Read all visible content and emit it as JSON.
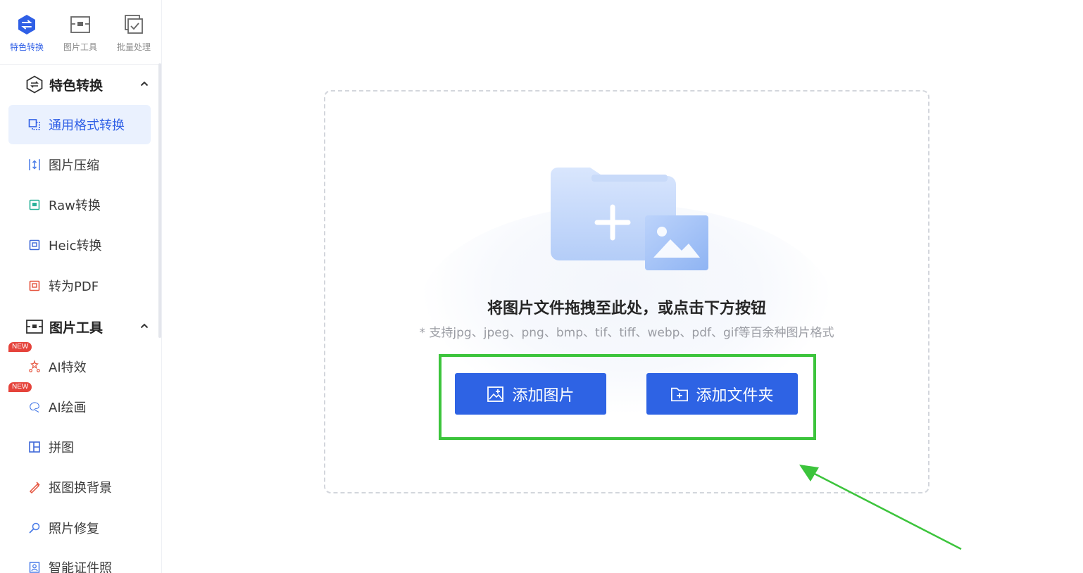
{
  "top_tabs": [
    {
      "label": "特色转换",
      "icon": "special-convert-icon",
      "active": true
    },
    {
      "label": "图片工具",
      "icon": "image-tools-icon",
      "active": false
    },
    {
      "label": "批量处理",
      "icon": "batch-process-icon",
      "active": false
    }
  ],
  "sidebar": {
    "groups": [
      {
        "title": "特色转换",
        "icon": "special-convert-icon",
        "expanded": true,
        "items": [
          {
            "label": "通用格式转换",
            "icon": "format-convert-icon",
            "active": true
          },
          {
            "label": "图片压缩",
            "icon": "compress-icon"
          },
          {
            "label": "Raw转换",
            "icon": "raw-convert-icon"
          },
          {
            "label": "Heic转换",
            "icon": "heic-convert-icon"
          },
          {
            "label": "转为PDF",
            "icon": "pdf-convert-icon"
          }
        ]
      },
      {
        "title": "图片工具",
        "icon": "image-tools-icon",
        "expanded": true,
        "items": [
          {
            "label": "AI特效",
            "icon": "ai-effect-icon",
            "badge": "NEW"
          },
          {
            "label": "AI绘画",
            "icon": "ai-paint-icon",
            "badge": "NEW"
          },
          {
            "label": "拼图",
            "icon": "collage-icon"
          },
          {
            "label": "抠图换背景",
            "icon": "cutout-icon"
          },
          {
            "label": "照片修复",
            "icon": "photo-repair-icon"
          },
          {
            "label": "智能证件照",
            "icon": "id-photo-icon"
          }
        ]
      }
    ]
  },
  "main": {
    "drop_title": "将图片文件拖拽至此处，或点击下方按钮",
    "drop_hint": "* 支持jpg、jpeg、png、bmp、tif、tiff、webp、pdf、gif等百余种图片格式",
    "buttons": {
      "add_image": "添加图片",
      "add_folder": "添加文件夹"
    }
  },
  "colors": {
    "accent": "#2e63e4",
    "highlight": "#3cc43c",
    "badge": "#e5433b"
  }
}
